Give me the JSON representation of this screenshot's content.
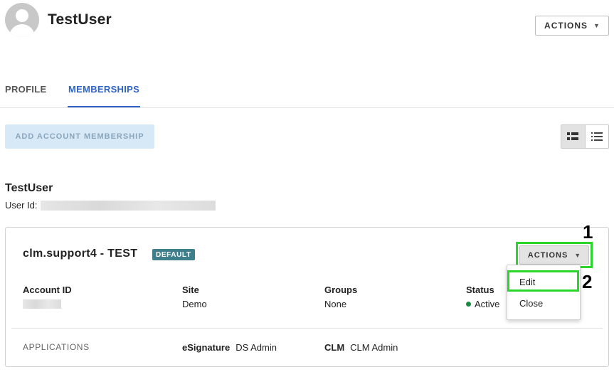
{
  "header": {
    "user_name": "TestUser",
    "actions_label": "ACTIONS"
  },
  "tabs": [
    {
      "label": "PROFILE",
      "active": false
    },
    {
      "label": "MEMBERSHIPS",
      "active": true
    }
  ],
  "toolbar": {
    "add_label": "ADD ACCOUNT MEMBERSHIP",
    "view_options": [
      "card-view-icon",
      "list-view-icon"
    ]
  },
  "user_section": {
    "name": "TestUser",
    "user_id_label": "User Id:"
  },
  "membership": {
    "account_name": "clm.support4 - TEST",
    "badge": "DEFAULT",
    "actions_label": "ACTIONS",
    "fields": {
      "account_id_label": "Account ID",
      "site_label": "Site",
      "site_value": "Demo",
      "groups_label": "Groups",
      "groups_value": "None",
      "status_label": "Status",
      "status_value": "Active"
    },
    "applications_label": "APPLICATIONS",
    "applications": [
      {
        "name": "eSignature",
        "role": "DS Admin"
      },
      {
        "name": "CLM",
        "role": "CLM Admin"
      }
    ]
  },
  "dropdown": {
    "items": [
      "Edit",
      "Close"
    ]
  },
  "annotations": [
    "1",
    "2"
  ],
  "colors": {
    "accent": "#2f63c4",
    "highlight": "#2bd62b",
    "badge": "#3f7f8c",
    "status_active": "#1a8a3e"
  }
}
